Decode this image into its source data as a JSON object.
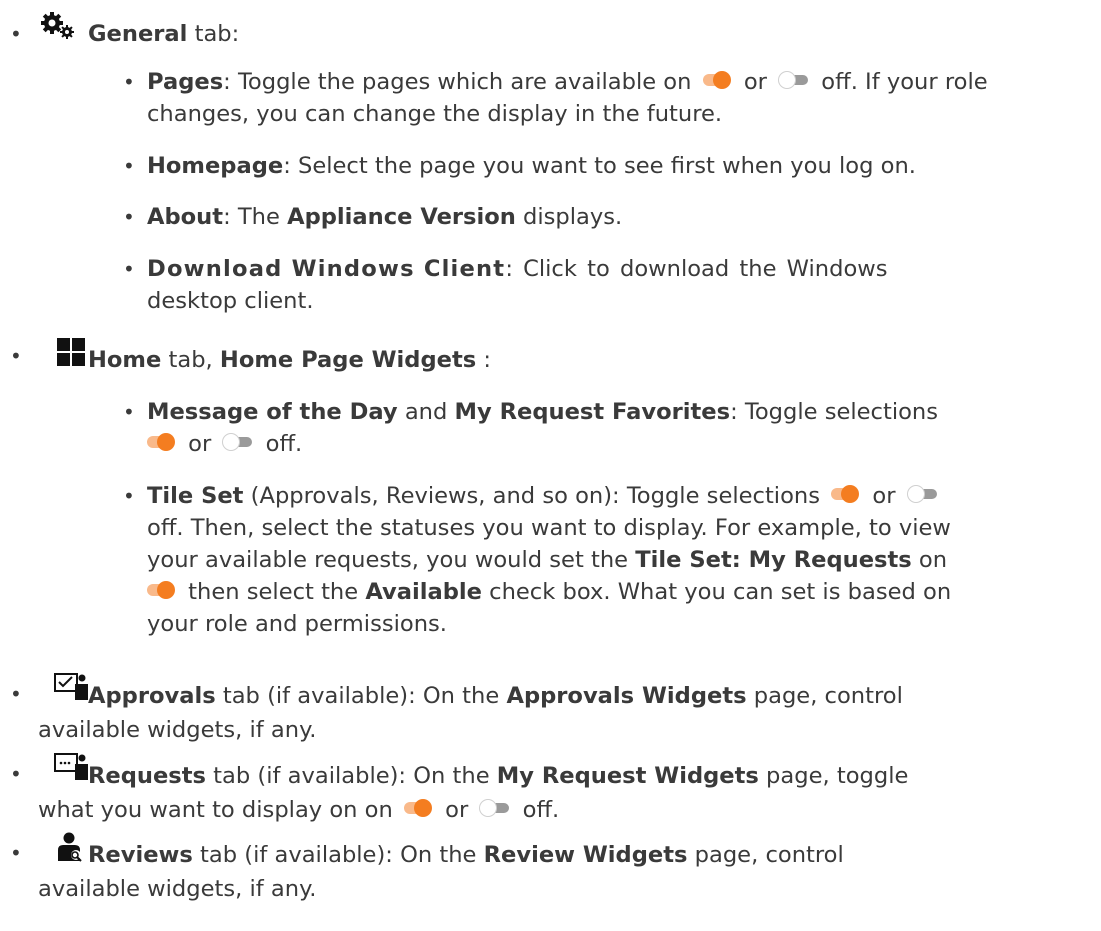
{
  "items": [
    {
      "tab": "General",
      "tab_suffix": " tab:",
      "icon": "gears-icon",
      "sub": [
        {
          "label": "Pages",
          "t1": ": Toggle the pages which are available on ",
          "t2": " or ",
          "t3": " off. If your role",
          "t4": "changes, you can change the display in the future."
        },
        {
          "label": "Homepage",
          "t1": ": Select the page you want to see first when you log on."
        },
        {
          "label": "About",
          "t1": ": The ",
          "label2": "Appliance Version",
          "t2": " displays."
        },
        {
          "label": "Download Windows Client",
          "t1": ": Click to download the Windows",
          "t2": "desktop client."
        }
      ]
    },
    {
      "tab": "Home",
      "tab_suffix": " tab, ",
      "tab2": "Home Page Widgets",
      "tab2_suffix": " :",
      "icon": "grid-icon",
      "sub": [
        {
          "label": "Message of the Day",
          "t1": " and ",
          "label2": "My Request Favorites",
          "t2": ": Toggle selections",
          "t3": " or ",
          "t4": " off."
        },
        {
          "label": "Tile Set",
          "t1": " (Approvals, Reviews, and so on): Toggle selections ",
          "t2": " or ",
          "t3": "off. Then, select the statuses you want to display. For example, to view",
          "t4": "your available requests, you would set the ",
          "label2": "Tile Set: My Requests",
          "t5": " on",
          "t6": " then select the ",
          "label3": "Available",
          "t7": " check box. What you can set is based on",
          "t8": "your role and permissions."
        }
      ]
    },
    {
      "tab": "Approvals",
      "tab_suffix": " tab (if available): On the ",
      "tab2": "Approvals Widgets",
      "tab2_suffix": " page, control",
      "line2": "available widgets, if any.",
      "icon": "approvals-icon"
    },
    {
      "tab": "Requests",
      "tab_suffix": " tab (if available): On the ",
      "tab2": "My Request Widgets",
      "tab2_suffix": " page, toggle",
      "line2a": "what you want to display on on ",
      "line2b": " or ",
      "line2c": " off.",
      "icon": "requests-icon"
    },
    {
      "tab": "Reviews",
      "tab_suffix": " tab (if available): On the ",
      "tab2": "Review Widgets",
      "tab2_suffix": " page, control",
      "line2": "available widgets, if any.",
      "icon": "reviews-icon"
    }
  ],
  "colors": {
    "text": "#3a3a3a",
    "toggle_on": "#f47d20",
    "toggle_on_track": "#f9b98a",
    "toggle_off_track": "#9a9a9a"
  }
}
